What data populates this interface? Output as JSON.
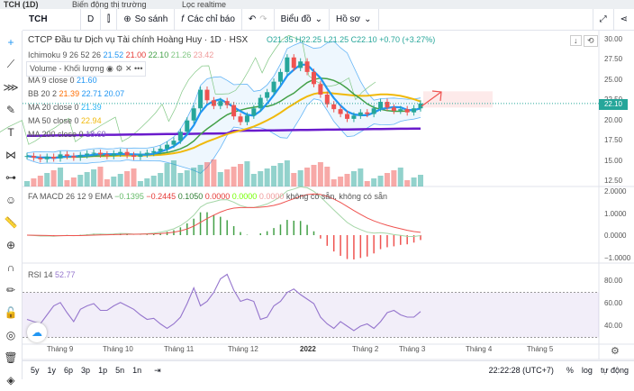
{
  "tabs": [
    "TCH (1D)",
    "Biến động thị trường",
    "Lọc realtime"
  ],
  "toolbar": {
    "symbol": "TCH",
    "interval": "D",
    "compare": "So sánh",
    "indicators": "Các chỉ báo",
    "chart_type": "Biểu đồ",
    "profile": "Hồ sơ"
  },
  "header": {
    "title": "CTCP Đầu tư Dịch vụ Tài chính Hoàng Huy · 1D · HSX",
    "o": "O21.35",
    "h": "H22.25",
    "l": "L21.25",
    "c": "C22.10",
    "change": "+0.70 (+3.27%)"
  },
  "indicators": {
    "ichimoku": {
      "label": "Ichimoku 9 26 52 26",
      "v": [
        "21.52",
        "21.00",
        "22.10",
        "21.26",
        "23.42"
      ]
    },
    "volume": {
      "label": "Volume - Khối lượng"
    },
    "ma9": {
      "label": "MA 9 close 0",
      "v": "21.60"
    },
    "bb": {
      "label": "BB 20 2",
      "v": [
        "21.39",
        "22.71",
        "20.07"
      ]
    },
    "ma20": {
      "label": "MA 20 close 0",
      "v": "21.39"
    },
    "ma50": {
      "label": "MA 50 close 0",
      "v": "22.94"
    },
    "ma200": {
      "label": "MA 200 close 0",
      "v": "18.69"
    },
    "macd": {
      "label": "FA MACD 26 12 9 EMA",
      "v": [
        "−0.1395",
        "−0.2445",
        "0.1050",
        "0.0000",
        "0.0000",
        "0.0000"
      ],
      "na": "không có sẵn, không có sẵn"
    },
    "rsi": {
      "label": "RSI 14",
      "v": "52.77"
    }
  },
  "price_axis": [
    "30.00",
    "27.50",
    "25.00",
    "22.50",
    "20.00",
    "17.50",
    "15.00",
    "12.50"
  ],
  "last_price": "22.10",
  "macd_axis": [
    "2.0000",
    "1.0000",
    "0.0000",
    "−1.0000"
  ],
  "rsi_axis": [
    "80.00",
    "60.00",
    "40.00"
  ],
  "time_axis": [
    "Tháng 9",
    "Tháng 10",
    "Tháng 11",
    "Tháng 12",
    "2022",
    "Tháng 2",
    "Tháng 3",
    "Tháng 4",
    "Tháng 5"
  ],
  "ranges": [
    "5y",
    "1y",
    "6p",
    "3p",
    "1p",
    "5n",
    "1n"
  ],
  "clock": "22:22:28 (UTC+7)",
  "scale_opts": [
    "%",
    "log",
    "tự động"
  ],
  "colors": {
    "up": "#26a69a",
    "down": "#ef5350",
    "ma9": "#2196f3",
    "ma50": "#f0b90b",
    "ma200": "#6a1bcc",
    "rsi": "#9575cd"
  },
  "chart_data": {
    "type": "candlestick",
    "close": [
      15.6,
      15.4,
      15.2,
      15.5,
      15.3,
      15.8,
      15.6,
      15.4,
      15.7,
      15.9,
      16.0,
      15.8,
      15.6,
      15.9,
      16.1,
      15.7,
      15.5,
      15.8,
      16.0,
      16.2,
      16.5,
      17.0,
      17.5,
      18.6,
      20.0,
      21.5,
      23.8,
      22.5,
      21.8,
      22.4,
      21.9,
      20.5,
      19.8,
      20.6,
      21.5,
      22.8,
      23.5,
      24.8,
      26.0,
      27.8,
      26.5,
      27.3,
      26.0,
      24.5,
      23.2,
      22.0,
      21.4,
      20.8,
      20.2,
      20.6,
      21.0,
      20.8,
      21.5,
      22.3,
      21.6,
      21.2,
      21.4,
      21.0,
      21.5,
      22.1
    ],
    "rsi": [
      46,
      44,
      42,
      50,
      58,
      61,
      52,
      44,
      55,
      58,
      60,
      54,
      54,
      58,
      61,
      58,
      55,
      50,
      46,
      47,
      42,
      38,
      42,
      48,
      60,
      74,
      58,
      62,
      70,
      82,
      86,
      72,
      62,
      64,
      62,
      46,
      48,
      58,
      62,
      70,
      73,
      68,
      64,
      60,
      48,
      42,
      38,
      44,
      40,
      36,
      40,
      42,
      38,
      44,
      52,
      54,
      50,
      48,
      48,
      53
    ],
    "price_range": [
      12.5,
      30
    ],
    "macd_range": [
      -1,
      2
    ],
    "rsi_range": [
      30,
      80
    ],
    "rsi_band": [
      30,
      70
    ]
  }
}
